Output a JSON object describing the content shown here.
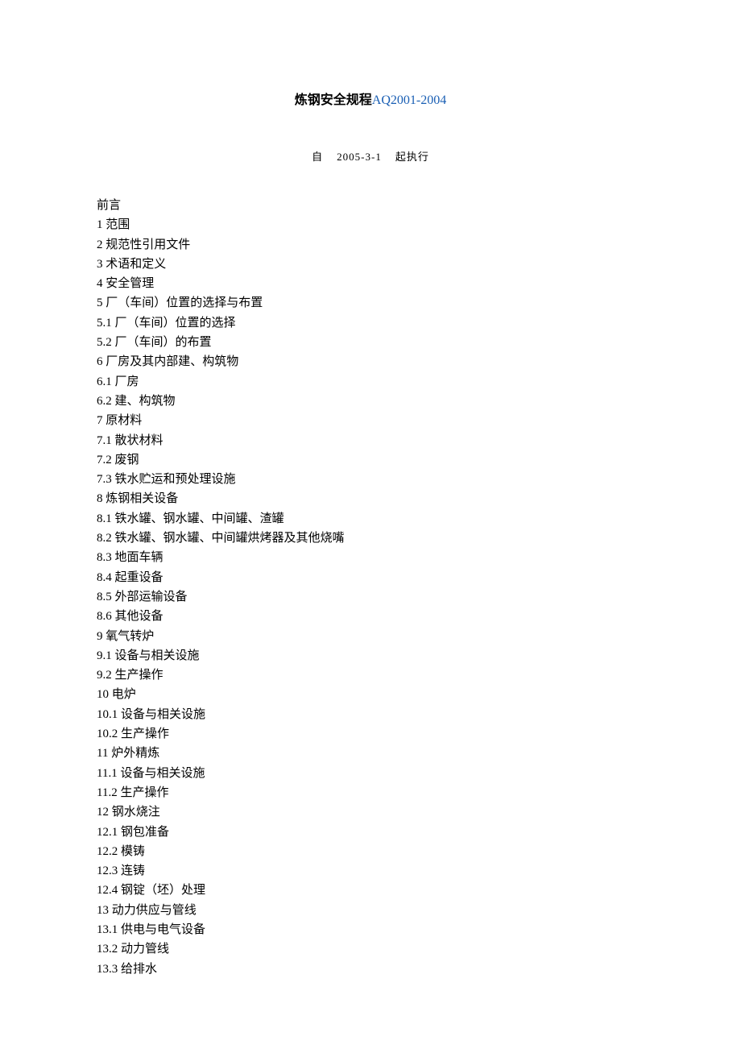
{
  "title": {
    "main": "炼钢安全规程",
    "code": "AQ2001-2004"
  },
  "effective": {
    "from": "自",
    "date": "2005-3-1",
    "exec": "起执行"
  },
  "toc": [
    "前言",
    "1 范围",
    "2 规范性引用文件",
    "3 术语和定义",
    "4 安全管理",
    "5 厂（车间）位置的选择与布置",
    "5.1 厂（车间）位置的选择",
    "5.2 厂（车间）的布置",
    "6 厂房及其内部建、构筑物",
    "6.1 厂房",
    "6.2 建、构筑物",
    "7 原材料",
    "7.1 散状材料",
    "7.2 废钢",
    "7.3 铁水贮运和预处理设施",
    "8 炼钢相关设备",
    "8.1 铁水罐、钢水罐、中间罐、渣罐",
    "8.2 铁水罐、钢水罐、中间罐烘烤器及其他烧嘴",
    "8.3 地面车辆",
    "8.4 起重设备",
    "8.5 外部运输设备",
    "8.6 其他设备",
    "9 氧气转炉",
    "9.1 设备与相关设施",
    "9.2 生产操作",
    "10 电炉",
    "10.1 设备与相关设施",
    "10.2 生产操作",
    "11 炉外精炼",
    "11.1 设备与相关设施",
    "11.2 生产操作",
    "12 钢水烧注",
    "12.1 钢包准备",
    "12.2 模铸",
    "12.3 连铸",
    "12.4 钢锭（坯）处理",
    "13 动力供应与管线",
    "13.1 供电与电气设备",
    "13.2 动力管线",
    "13.3 给排水"
  ]
}
